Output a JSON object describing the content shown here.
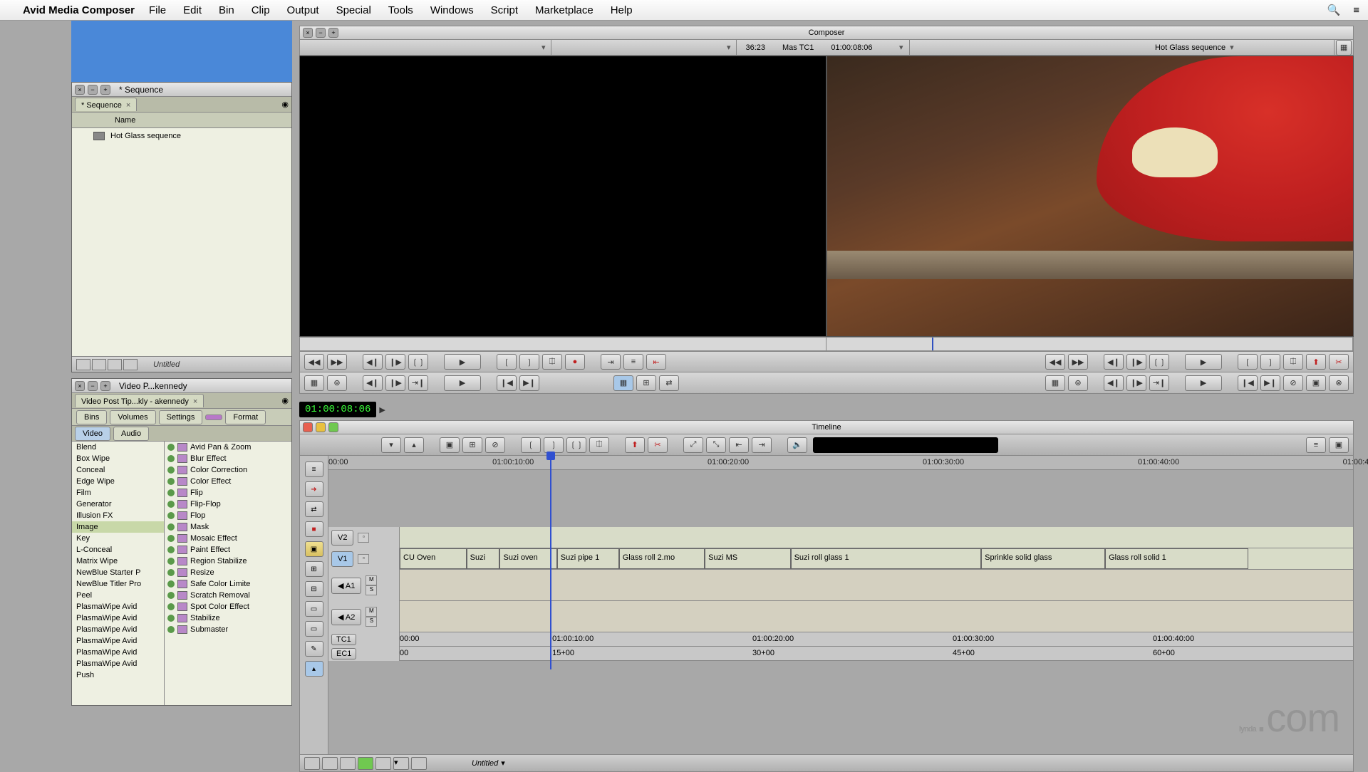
{
  "menubar": {
    "app": "Avid Media Composer",
    "items": [
      "File",
      "Edit",
      "Bin",
      "Clip",
      "Output",
      "Special",
      "Tools",
      "Windows",
      "Script",
      "Marketplace",
      "Help"
    ]
  },
  "bin": {
    "title": "* Sequence",
    "tab": "* Sequence",
    "header": "Name",
    "items": [
      {
        "name": "Hot Glass sequence"
      }
    ],
    "footer_label": "Untitled"
  },
  "fx": {
    "title": "Video P...kennedy",
    "tab": "Video Post Tip...kly - akennedy",
    "subtabs": [
      "Bins",
      "Volumes",
      "Settings",
      "",
      "Format"
    ],
    "maintabs": [
      "Video",
      "Audio"
    ],
    "categories": [
      "Blend",
      "Box Wipe",
      "Conceal",
      "Edge Wipe",
      "Film",
      "Generator",
      "Illusion FX",
      "Image",
      "Key",
      "L-Conceal",
      "Matrix Wipe",
      "NewBlue Starter P",
      "NewBlue Titler Pro",
      "Peel",
      "PlasmaWipe Avid",
      "PlasmaWipe Avid",
      "PlasmaWipe Avid",
      "PlasmaWipe Avid",
      "PlasmaWipe Avid",
      "PlasmaWipe Avid",
      "Push"
    ],
    "selected_cat": "Image",
    "effects": [
      "Avid Pan & Zoom",
      "Blur Effect",
      "Color Correction",
      "Color Effect",
      "Flip",
      "Flip-Flop",
      "Flop",
      "Mask",
      "Mosaic Effect",
      "Paint Effect",
      "Region Stabilize",
      "Resize",
      "Safe Color Limite",
      "Scratch Removal",
      "Spot Color Effect",
      "Stabilize",
      "Submaster"
    ]
  },
  "composer": {
    "title": "Composer",
    "src_dur": "36:23",
    "mas_label": "Mas   TC1",
    "rec_tc": "01:00:08:06",
    "seq_name": "Hot Glass sequence"
  },
  "timeline": {
    "title": "Timeline",
    "tc": "01:00:08:06",
    "ruler": [
      {
        "pos": 0,
        "label": "00:00"
      },
      {
        "pos": 16,
        "label": "01:00:10:00"
      },
      {
        "pos": 37,
        "label": "01:00:20:00"
      },
      {
        "pos": 58,
        "label": "01:00:30:00"
      },
      {
        "pos": 79,
        "label": "01:00:40:00"
      },
      {
        "pos": 99,
        "label": "01:00:4"
      }
    ],
    "tracks": {
      "v2": "V2",
      "v1": "V1",
      "a1": "A1",
      "a2": "A2",
      "tc1": "TC1",
      "ec1": "EC1"
    },
    "clips": [
      {
        "name": "CU Oven",
        "start": 0,
        "w": 7
      },
      {
        "name": "Suzi",
        "start": 7,
        "w": 3.5
      },
      {
        "name": "Suzi oven",
        "start": 10.5,
        "w": 6
      },
      {
        "name": "Suzi pipe 1",
        "start": 16.5,
        "w": 6.5
      },
      {
        "name": "Glass roll 2.mo",
        "start": 23,
        "w": 9
      },
      {
        "name": "Suzi MS",
        "start": 32,
        "w": 9
      },
      {
        "name": "Suzi roll glass 1",
        "start": 41,
        "w": 20
      },
      {
        "name": "Sprinkle solid glass",
        "start": 61,
        "w": 13
      },
      {
        "name": "Glass roll solid 1",
        "start": 74,
        "w": 15
      }
    ],
    "tc_row": [
      {
        "pos": 0,
        "label": "00:00"
      },
      {
        "pos": 16,
        "label": "01:00:10:00"
      },
      {
        "pos": 37,
        "label": "01:00:20:00"
      },
      {
        "pos": 58,
        "label": "01:00:30:00"
      },
      {
        "pos": 79,
        "label": "01:00:40:00"
      }
    ],
    "ec_row": [
      {
        "pos": 0,
        "label": "00"
      },
      {
        "pos": 16,
        "label": "15+00"
      },
      {
        "pos": 37,
        "label": "30+00"
      },
      {
        "pos": 58,
        "label": "45+00"
      },
      {
        "pos": 79,
        "label": "60+00"
      }
    ],
    "playhead_pct": 16.5,
    "footer_label": "Untitled"
  },
  "watermark": "lynda.com"
}
